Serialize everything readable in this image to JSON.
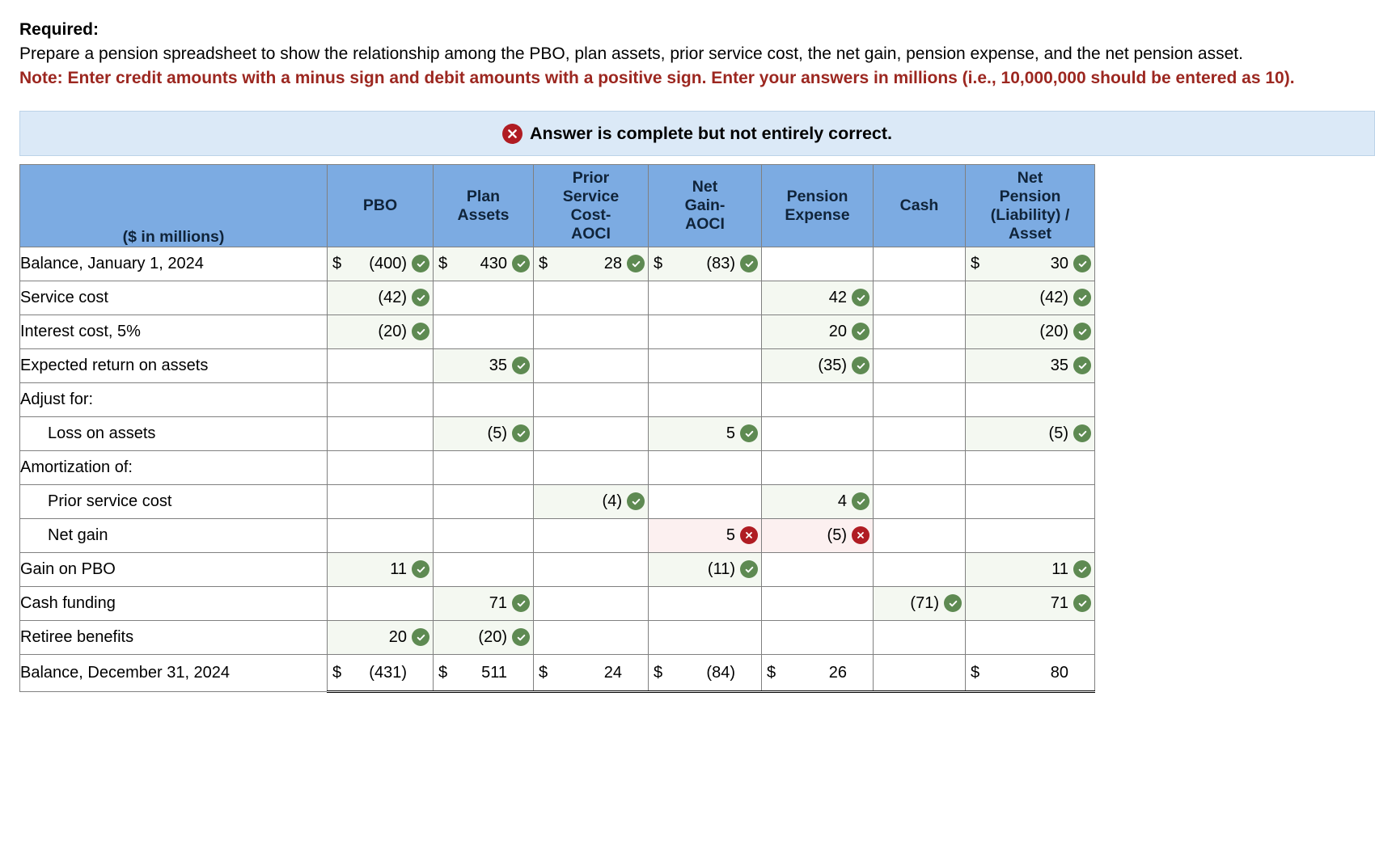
{
  "prompt": {
    "required_label": "Required:",
    "required_text": "Prepare a pension spreadsheet to show the relationship among the PBO, plan assets, prior service cost, the net gain, pension expense, and the net pension asset.",
    "note_text": "Note: Enter credit amounts with a minus sign and debit amounts with a positive sign. Enter your answers in millions (i.e., 10,000,000 should be entered as 10)."
  },
  "banner": {
    "icon": "x-circle-icon",
    "text": "Answer is complete but not entirely correct.",
    "background_color": "#dbe9f7",
    "icon_color": "#b01c23"
  },
  "colors": {
    "header_blue": "#7cabe2",
    "correct_green": "#5e8a52",
    "incorrect_red": "#b01c23",
    "correct_cell_bg": "#f4f8f1",
    "incorrect_cell_bg": "#fcf0f0",
    "note_red": "#9c2720"
  },
  "table": {
    "headers": [
      "($ in millions)",
      "PBO",
      "Plan Assets",
      "Prior Service Cost- AOCI",
      "Net Gain- AOCI",
      "Pension Expense",
      "Cash",
      "Net Pension (Liability) / Asset"
    ],
    "header_lines": [
      [
        "($ in millions)"
      ],
      [
        "PBO"
      ],
      [
        "Plan",
        "Assets"
      ],
      [
        "Prior",
        "Service",
        "Cost-",
        "AOCI"
      ],
      [
        "Net",
        "Gain-",
        "AOCI"
      ],
      [
        "Pension",
        "Expense"
      ],
      [
        "Cash"
      ],
      [
        "Net",
        "Pension",
        "(Liability) /",
        "Asset"
      ]
    ],
    "rows": [
      {
        "label": "Balance, January 1, 2024",
        "indent": false,
        "is_total": false,
        "cells": [
          {
            "dollar": "$",
            "amount": "(400)",
            "status": "correct"
          },
          {
            "dollar": "$",
            "amount": "430",
            "status": "correct"
          },
          {
            "dollar": "$",
            "amount": "28",
            "status": "correct"
          },
          {
            "dollar": "$",
            "amount": "(83)",
            "status": "correct"
          },
          {
            "dollar": "",
            "amount": "",
            "status": "none"
          },
          {
            "dollar": "",
            "amount": "",
            "status": "none"
          },
          {
            "dollar": "$",
            "amount": "30",
            "status": "correct"
          }
        ]
      },
      {
        "label": "Service cost",
        "indent": false,
        "is_total": false,
        "cells": [
          {
            "dollar": "",
            "amount": "(42)",
            "status": "correct"
          },
          {
            "dollar": "",
            "amount": "",
            "status": "none"
          },
          {
            "dollar": "",
            "amount": "",
            "status": "none"
          },
          {
            "dollar": "",
            "amount": "",
            "status": "none"
          },
          {
            "dollar": "",
            "amount": "42",
            "status": "correct"
          },
          {
            "dollar": "",
            "amount": "",
            "status": "none"
          },
          {
            "dollar": "",
            "amount": "(42)",
            "status": "correct"
          }
        ]
      },
      {
        "label": "Interest cost, 5%",
        "indent": false,
        "is_total": false,
        "cells": [
          {
            "dollar": "",
            "amount": "(20)",
            "status": "correct"
          },
          {
            "dollar": "",
            "amount": "",
            "status": "none"
          },
          {
            "dollar": "",
            "amount": "",
            "status": "none"
          },
          {
            "dollar": "",
            "amount": "",
            "status": "none"
          },
          {
            "dollar": "",
            "amount": "20",
            "status": "correct"
          },
          {
            "dollar": "",
            "amount": "",
            "status": "none"
          },
          {
            "dollar": "",
            "amount": "(20)",
            "status": "correct"
          }
        ]
      },
      {
        "label": "Expected return on assets",
        "indent": false,
        "is_total": false,
        "cells": [
          {
            "dollar": "",
            "amount": "",
            "status": "none"
          },
          {
            "dollar": "",
            "amount": "35",
            "status": "correct"
          },
          {
            "dollar": "",
            "amount": "",
            "status": "none"
          },
          {
            "dollar": "",
            "amount": "",
            "status": "none"
          },
          {
            "dollar": "",
            "amount": "(35)",
            "status": "correct"
          },
          {
            "dollar": "",
            "amount": "",
            "status": "none"
          },
          {
            "dollar": "",
            "amount": "35",
            "status": "correct"
          }
        ]
      },
      {
        "label": "Adjust for:",
        "indent": false,
        "is_total": false,
        "cells": [
          {
            "dollar": "",
            "amount": "",
            "status": "none"
          },
          {
            "dollar": "",
            "amount": "",
            "status": "none"
          },
          {
            "dollar": "",
            "amount": "",
            "status": "none"
          },
          {
            "dollar": "",
            "amount": "",
            "status": "none"
          },
          {
            "dollar": "",
            "amount": "",
            "status": "none"
          },
          {
            "dollar": "",
            "amount": "",
            "status": "none"
          },
          {
            "dollar": "",
            "amount": "",
            "status": "none"
          }
        ]
      },
      {
        "label": "Loss on assets",
        "indent": true,
        "is_total": false,
        "cells": [
          {
            "dollar": "",
            "amount": "",
            "status": "none"
          },
          {
            "dollar": "",
            "amount": "(5)",
            "status": "correct"
          },
          {
            "dollar": "",
            "amount": "",
            "status": "none"
          },
          {
            "dollar": "",
            "amount": "5",
            "status": "correct"
          },
          {
            "dollar": "",
            "amount": "",
            "status": "none"
          },
          {
            "dollar": "",
            "amount": "",
            "status": "none"
          },
          {
            "dollar": "",
            "amount": "(5)",
            "status": "correct"
          }
        ]
      },
      {
        "label": "Amortization of:",
        "indent": false,
        "is_total": false,
        "cells": [
          {
            "dollar": "",
            "amount": "",
            "status": "none"
          },
          {
            "dollar": "",
            "amount": "",
            "status": "none"
          },
          {
            "dollar": "",
            "amount": "",
            "status": "none"
          },
          {
            "dollar": "",
            "amount": "",
            "status": "none"
          },
          {
            "dollar": "",
            "amount": "",
            "status": "none"
          },
          {
            "dollar": "",
            "amount": "",
            "status": "none"
          },
          {
            "dollar": "",
            "amount": "",
            "status": "none"
          }
        ]
      },
      {
        "label": "Prior service cost",
        "indent": true,
        "is_total": false,
        "cells": [
          {
            "dollar": "",
            "amount": "",
            "status": "none"
          },
          {
            "dollar": "",
            "amount": "",
            "status": "none"
          },
          {
            "dollar": "",
            "amount": "(4)",
            "status": "correct"
          },
          {
            "dollar": "",
            "amount": "",
            "status": "none"
          },
          {
            "dollar": "",
            "amount": "4",
            "status": "correct"
          },
          {
            "dollar": "",
            "amount": "",
            "status": "none"
          },
          {
            "dollar": "",
            "amount": "",
            "status": "none"
          }
        ]
      },
      {
        "label": "Net gain",
        "indent": true,
        "is_total": false,
        "cells": [
          {
            "dollar": "",
            "amount": "",
            "status": "none"
          },
          {
            "dollar": "",
            "amount": "",
            "status": "none"
          },
          {
            "dollar": "",
            "amount": "",
            "status": "none"
          },
          {
            "dollar": "",
            "amount": "5",
            "status": "incorrect"
          },
          {
            "dollar": "",
            "amount": "(5)",
            "status": "incorrect"
          },
          {
            "dollar": "",
            "amount": "",
            "status": "none"
          },
          {
            "dollar": "",
            "amount": "",
            "status": "none"
          }
        ]
      },
      {
        "label": "Gain on PBO",
        "indent": false,
        "is_total": false,
        "cells": [
          {
            "dollar": "",
            "amount": "11",
            "status": "correct"
          },
          {
            "dollar": "",
            "amount": "",
            "status": "none"
          },
          {
            "dollar": "",
            "amount": "",
            "status": "none"
          },
          {
            "dollar": "",
            "amount": "(11)",
            "status": "correct"
          },
          {
            "dollar": "",
            "amount": "",
            "status": "none"
          },
          {
            "dollar": "",
            "amount": "",
            "status": "none"
          },
          {
            "dollar": "",
            "amount": "11",
            "status": "correct"
          }
        ]
      },
      {
        "label": "Cash funding",
        "indent": false,
        "is_total": false,
        "cells": [
          {
            "dollar": "",
            "amount": "",
            "status": "none"
          },
          {
            "dollar": "",
            "amount": "71",
            "status": "correct"
          },
          {
            "dollar": "",
            "amount": "",
            "status": "none"
          },
          {
            "dollar": "",
            "amount": "",
            "status": "none"
          },
          {
            "dollar": "",
            "amount": "",
            "status": "none"
          },
          {
            "dollar": "",
            "amount": "(71)",
            "status": "correct"
          },
          {
            "dollar": "",
            "amount": "71",
            "status": "correct"
          }
        ]
      },
      {
        "label": "Retiree benefits",
        "indent": false,
        "is_total": false,
        "cells": [
          {
            "dollar": "",
            "amount": "20",
            "status": "correct"
          },
          {
            "dollar": "",
            "amount": "(20)",
            "status": "correct"
          },
          {
            "dollar": "",
            "amount": "",
            "status": "none"
          },
          {
            "dollar": "",
            "amount": "",
            "status": "none"
          },
          {
            "dollar": "",
            "amount": "",
            "status": "none"
          },
          {
            "dollar": "",
            "amount": "",
            "status": "none"
          },
          {
            "dollar": "",
            "amount": "",
            "status": "none"
          }
        ]
      },
      {
        "label": "Balance, December 31, 2024",
        "indent": false,
        "is_total": true,
        "cells": [
          {
            "dollar": "$",
            "amount": "(431)",
            "status": "none"
          },
          {
            "dollar": "$",
            "amount": "511",
            "status": "none"
          },
          {
            "dollar": "$",
            "amount": "24",
            "status": "none"
          },
          {
            "dollar": "$",
            "amount": "(84)",
            "status": "none"
          },
          {
            "dollar": "$",
            "amount": "26",
            "status": "none"
          },
          {
            "dollar": "",
            "amount": "",
            "status": "none"
          },
          {
            "dollar": "$",
            "amount": "80",
            "status": "none"
          }
        ]
      }
    ]
  }
}
